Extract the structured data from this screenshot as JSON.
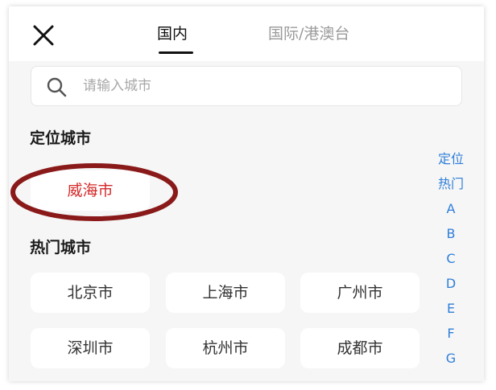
{
  "header": {
    "tabs": [
      {
        "label": "国内",
        "active": true
      },
      {
        "label": "国际/港澳台",
        "active": false
      }
    ]
  },
  "search": {
    "placeholder": "请输入城市"
  },
  "location_section": {
    "title": "定位城市",
    "current_city": "威海市"
  },
  "hot_section": {
    "title": "热门城市",
    "cities": [
      "北京市",
      "上海市",
      "广州市",
      "深圳市",
      "杭州市",
      "成都市"
    ]
  },
  "index_bar": {
    "items": [
      "定位",
      "热门",
      "A",
      "B",
      "C",
      "D",
      "E",
      "F",
      "G"
    ]
  },
  "colors": {
    "accent_blue": "#2f7fd8",
    "located_red": "#d42a2a",
    "annotation_circle": "#8a1a1a"
  },
  "icons": {
    "close": "close-icon",
    "search": "search-icon"
  }
}
